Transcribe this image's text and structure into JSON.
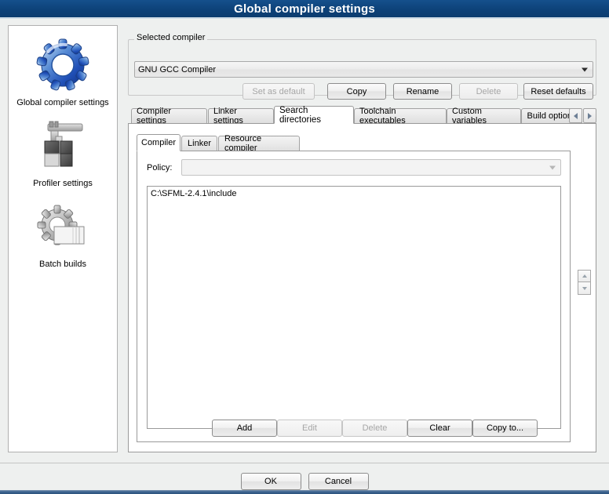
{
  "window": {
    "title": "Global compiler settings"
  },
  "sidebar": {
    "items": [
      {
        "label": "Global compiler settings",
        "icon": "blue-gear-icon",
        "selected": true
      },
      {
        "label": "Profiler settings",
        "icon": "caliper-blocks-icon",
        "selected": false
      },
      {
        "label": "Batch builds",
        "icon": "gray-gear-pages-icon",
        "selected": false
      }
    ]
  },
  "compiler_group": {
    "title": "Selected compiler",
    "selected_compiler": "GNU GCC Compiler",
    "dropdown_icon": "chevron-down-icon",
    "buttons": [
      {
        "label": "Set as default",
        "enabled": false
      },
      {
        "label": "Copy",
        "enabled": true
      },
      {
        "label": "Rename",
        "enabled": true
      },
      {
        "label": "Delete",
        "enabled": false
      },
      {
        "label": "Reset defaults",
        "enabled": true
      }
    ]
  },
  "tabs": {
    "items": [
      {
        "label": "Compiler settings",
        "active": false
      },
      {
        "label": "Linker settings",
        "active": false
      },
      {
        "label": "Search directories",
        "active": true
      },
      {
        "label": "Toolchain executables",
        "active": false
      },
      {
        "label": "Custom variables",
        "active": false
      },
      {
        "label": "Build options",
        "active": false
      }
    ],
    "scroll_left_icon": "triangle-left-icon",
    "scroll_right_icon": "triangle-right-icon"
  },
  "inner_tabs": {
    "items": [
      {
        "label": "Compiler",
        "active": true
      },
      {
        "label": "Linker",
        "active": false
      },
      {
        "label": "Resource compiler",
        "active": false
      }
    ]
  },
  "search_directories": {
    "policy_label": "Policy:",
    "policy_value": "",
    "policy_placeholder": "",
    "policy_icon": "chevron-down-icon",
    "paths": [
      "C:\\SFML-2.4.1\\include"
    ],
    "actions": [
      {
        "label": "Add",
        "enabled": true
      },
      {
        "label": "Edit",
        "enabled": false
      },
      {
        "label": "Delete",
        "enabled": false
      },
      {
        "label": "Clear",
        "enabled": true
      },
      {
        "label": "Copy to...",
        "enabled": true
      }
    ]
  },
  "spinner": {
    "up_icon": "triangle-up-icon",
    "down_icon": "triangle-down-icon"
  },
  "footer": {
    "ok_label": "OK",
    "cancel_label": "Cancel"
  },
  "colors": {
    "titlebar": "#0d4279",
    "window_bg": "#eef0ef",
    "panel_bg": "#ffffff",
    "accent_blue": "#2c537c"
  }
}
